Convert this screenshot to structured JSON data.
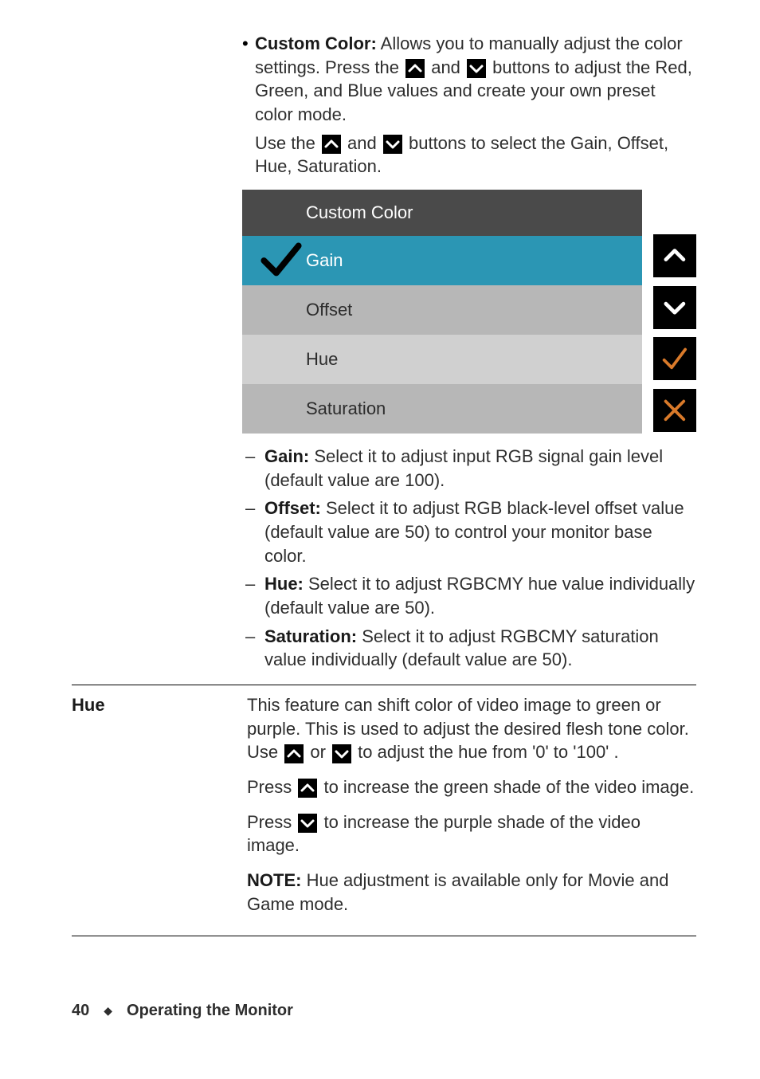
{
  "intro": {
    "bullet_label": "Custom Color:",
    "bullet_text_1": " Allows you to manually adjust the color settings. Press the ",
    "bullet_text_2": " and ",
    "bullet_text_3": " buttons to adjust the Red, Green, and Blue values and create your own preset color mode.",
    "use_1": "Use the ",
    "use_2": " and ",
    "use_3": " buttons to select the Gain, Offset, Hue, Saturation."
  },
  "menu": {
    "header": "Custom Color",
    "items": [
      "Gain",
      "Offset",
      "Hue",
      "Saturation"
    ]
  },
  "defs": {
    "gain_label": "Gain:",
    "gain_text": " Select it to adjust input RGB signal gain level (default value are 100).",
    "offset_label": "Offset:",
    "offset_text": " Select it to adjust RGB black-level offset value (default value are 50) to control your monitor base color.",
    "hue_label": "Hue:",
    "hue_text": " Select it to adjust RGBCMY hue value individually (default value are 50).",
    "sat_label": "Saturation:",
    "sat_text": " Select it to adjust RGBCMY saturation value individually (default value are 50)."
  },
  "hue_row": {
    "label": "Hue",
    "p1a": "This feature can shift color of video image to green or purple. This is used to adjust the desired flesh tone color. Use ",
    "p1b": " or ",
    "p1c": " to adjust the hue from '0' to '100' .",
    "p2a": "Press ",
    "p2b": " to increase the green shade of the video image.",
    "p3a": "Press ",
    "p3b": " to increase the purple shade of the video image.",
    "note_label": "NOTE:",
    "note_text": " Hue adjustment is available only for Movie and Game mode."
  },
  "footer": {
    "page": "40",
    "section": "Operating the Monitor"
  }
}
